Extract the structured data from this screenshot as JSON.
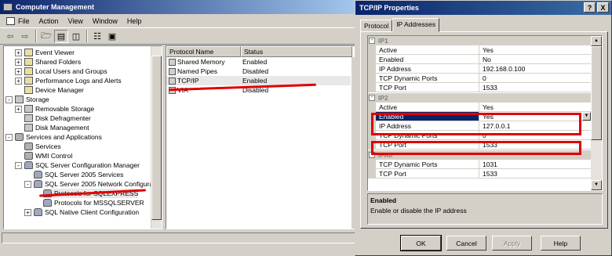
{
  "mmc": {
    "title": "Computer Management",
    "menu": [
      "File",
      "Action",
      "View",
      "Window",
      "Help"
    ],
    "tree": [
      {
        "label": "Event Viewer",
        "exp": "+"
      },
      {
        "label": "Shared Folders",
        "exp": "+"
      },
      {
        "label": "Local Users and Groups",
        "exp": "+"
      },
      {
        "label": "Performance Logs and Alerts",
        "exp": "+"
      },
      {
        "label": "Device Manager",
        "exp": ""
      },
      {
        "label": "Storage",
        "exp": "-"
      },
      {
        "label": "Removable Storage",
        "exp": "+"
      },
      {
        "label": "Disk Defragmenter",
        "exp": ""
      },
      {
        "label": "Disk Management",
        "exp": ""
      },
      {
        "label": "Services and Applications",
        "exp": "-"
      },
      {
        "label": "Services",
        "exp": ""
      },
      {
        "label": "WMI Control",
        "exp": ""
      },
      {
        "label": "SQL Server Configuration Manager",
        "exp": "-"
      },
      {
        "label": "SQL Server 2005 Services",
        "exp": ""
      },
      {
        "label": "SQL Server 2005 Network Configurat",
        "exp": "-"
      },
      {
        "label": "Protocols for SQLEXPRESS",
        "exp": ""
      },
      {
        "label": "Protocols for MSSQLSERVER",
        "exp": ""
      },
      {
        "label": "SQL Native Client Configuration",
        "exp": "+"
      }
    ],
    "list": {
      "headers": [
        "Protocol Name",
        "Status"
      ],
      "rows": [
        {
          "name": "Shared Memory",
          "status": "Enabled"
        },
        {
          "name": "Named Pipes",
          "status": "Disabled"
        },
        {
          "name": "TCP/IP",
          "status": "Enabled"
        },
        {
          "name": "VIA",
          "status": "Disabled"
        }
      ]
    }
  },
  "dialog": {
    "title": "TCP/IP Properties",
    "title_buttons": [
      "?",
      "X"
    ],
    "tabs": [
      "Protocol",
      "IP Addresses"
    ],
    "groups": [
      {
        "name": "IP1",
        "rows": [
          {
            "name": "Active",
            "value": "Yes"
          },
          {
            "name": "Enabled",
            "value": "No"
          },
          {
            "name": "IP Address",
            "value": "192.168.0.100"
          },
          {
            "name": "TCP Dynamic Ports",
            "value": "0"
          },
          {
            "name": "TCP Port",
            "value": "1533"
          }
        ]
      },
      {
        "name": "IP2",
        "rows": [
          {
            "name": "Active",
            "value": "Yes"
          },
          {
            "name": "Enabled",
            "value": "Yes"
          },
          {
            "name": "IP Address",
            "value": "127.0.0.1"
          },
          {
            "name": "TCP Dynamic Ports",
            "value": "0"
          },
          {
            "name": "TCP Port",
            "value": "1533"
          }
        ]
      },
      {
        "name": "IPAll",
        "rows": [
          {
            "name": "TCP Dynamic Ports",
            "value": "1031"
          },
          {
            "name": "TCP Port",
            "value": "1533"
          }
        ]
      }
    ],
    "description": {
      "title": "Enabled",
      "text": "Enable or disable the IP address"
    },
    "buttons": {
      "ok": "OK",
      "cancel": "Cancel",
      "apply": "Apply",
      "help": "Help"
    }
  },
  "colors": {
    "annotation": "#e00000",
    "selection": "#0a246a"
  }
}
